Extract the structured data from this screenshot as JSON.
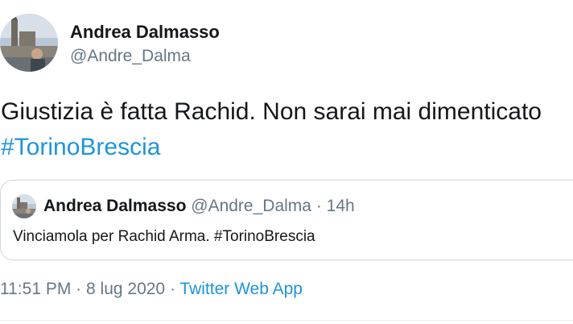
{
  "author": {
    "display_name": "Andrea Dalmasso",
    "handle": "@Andre_Dalma"
  },
  "tweet": {
    "text": "Giustizia è fatta Rachid. Non sarai mai dimenticato",
    "hashtag": "#TorinoBrescia"
  },
  "quoted_tweet": {
    "display_name": "Andrea Dalmasso",
    "handle": "@Andre_Dalma",
    "separator": "·",
    "age": "14h",
    "text": "Vinciamola per Rachid Arma. #TorinoBrescia"
  },
  "footer": {
    "time": "11:51 PM",
    "separator": "·",
    "date": "8 lug 2020",
    "app": "Twitter Web App"
  },
  "colors": {
    "link": "#1b95e0",
    "secondary_text": "#657786",
    "border": "#ccd6dd"
  }
}
